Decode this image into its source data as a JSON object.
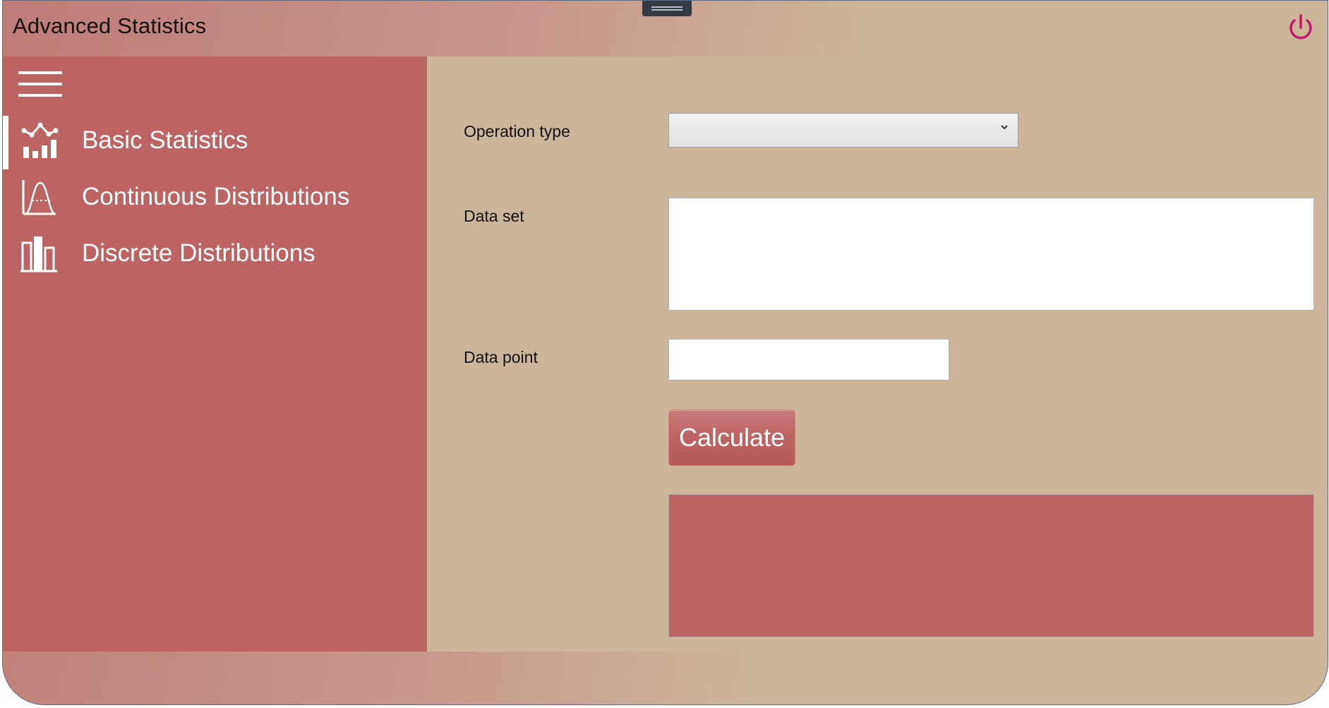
{
  "window": {
    "title": "Advanced Statistics",
    "accent_color": "#c2186e",
    "sidebar_color": "#bb6462",
    "content_color": "#cdb59a"
  },
  "sidebar": {
    "menu_icon": "hamburger-menu-icon",
    "items": [
      {
        "label": "Basic Statistics",
        "icon": "basic-statistics-icon",
        "selected": true
      },
      {
        "label": "Continuous Distributions",
        "icon": "bell-curve-icon",
        "selected": false
      },
      {
        "label": "Discrete Distributions",
        "icon": "bar-chart-icon",
        "selected": false
      }
    ]
  },
  "form": {
    "operation_type_label": "Operation type",
    "operation_type_value": "",
    "data_set_label": "Data set",
    "data_set_value": "",
    "data_point_label": "Data point",
    "data_point_value": "",
    "calculate_label": "Calculate",
    "result_text": ""
  }
}
